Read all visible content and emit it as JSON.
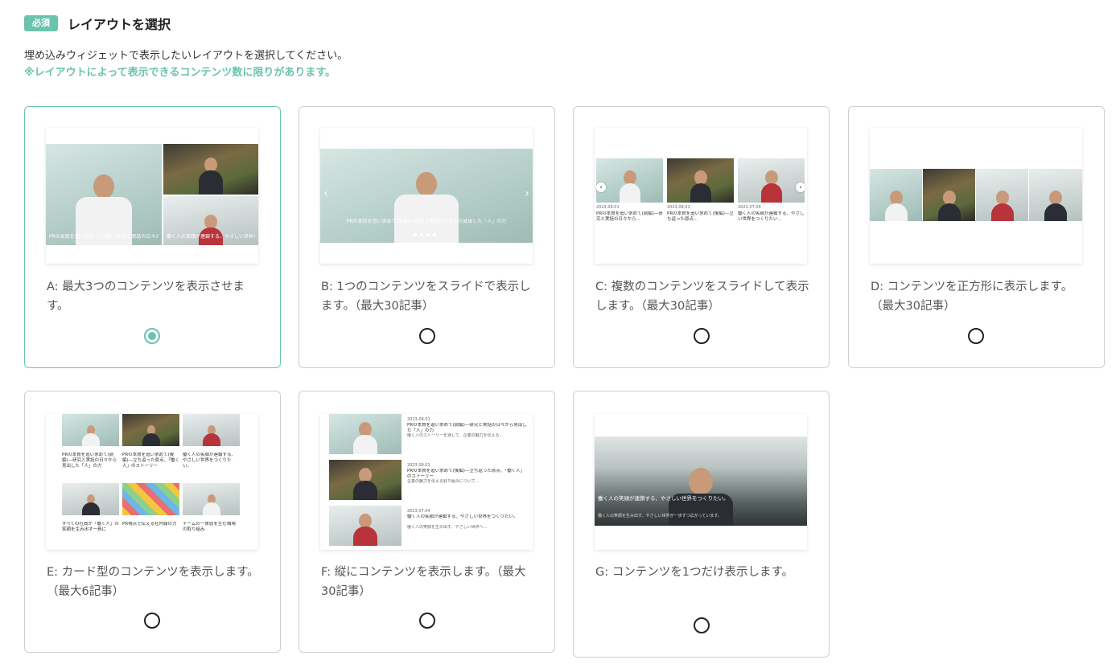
{
  "header": {
    "badge": "必須",
    "title": "レイアウトを選択",
    "description": "埋め込みウィジェットで表示したいレイアウトを選択してください。",
    "note": "※レイアウトによって表示できるコンテンツ数に限りがあります。"
  },
  "layouts": [
    {
      "id": "A",
      "label": "A: 最大3つのコンテンツを表示させます。",
      "selected": true
    },
    {
      "id": "B",
      "label": "B: 1つのコンテンツをスライドで表示します。（最大30記事）",
      "selected": false
    },
    {
      "id": "C",
      "label": "C: 複数のコンテンツをスライドして表示します。（最大30記事）",
      "selected": false
    },
    {
      "id": "D",
      "label": "D: コンテンツを正方形に表示します。（最大30記事）",
      "selected": false
    },
    {
      "id": "E",
      "label": "E: カード型のコンテンツを表示します。（最大6記事）",
      "selected": false
    },
    {
      "id": "F",
      "label": "F: 縦にコンテンツを表示します。（最大30記事）",
      "selected": false
    },
    {
      "id": "G",
      "label": "G: コンテンツを1つだけ表示します。",
      "selected": false
    }
  ],
  "colors": {
    "accent": "#6cc3ad",
    "border": "#cfcfcf"
  }
}
